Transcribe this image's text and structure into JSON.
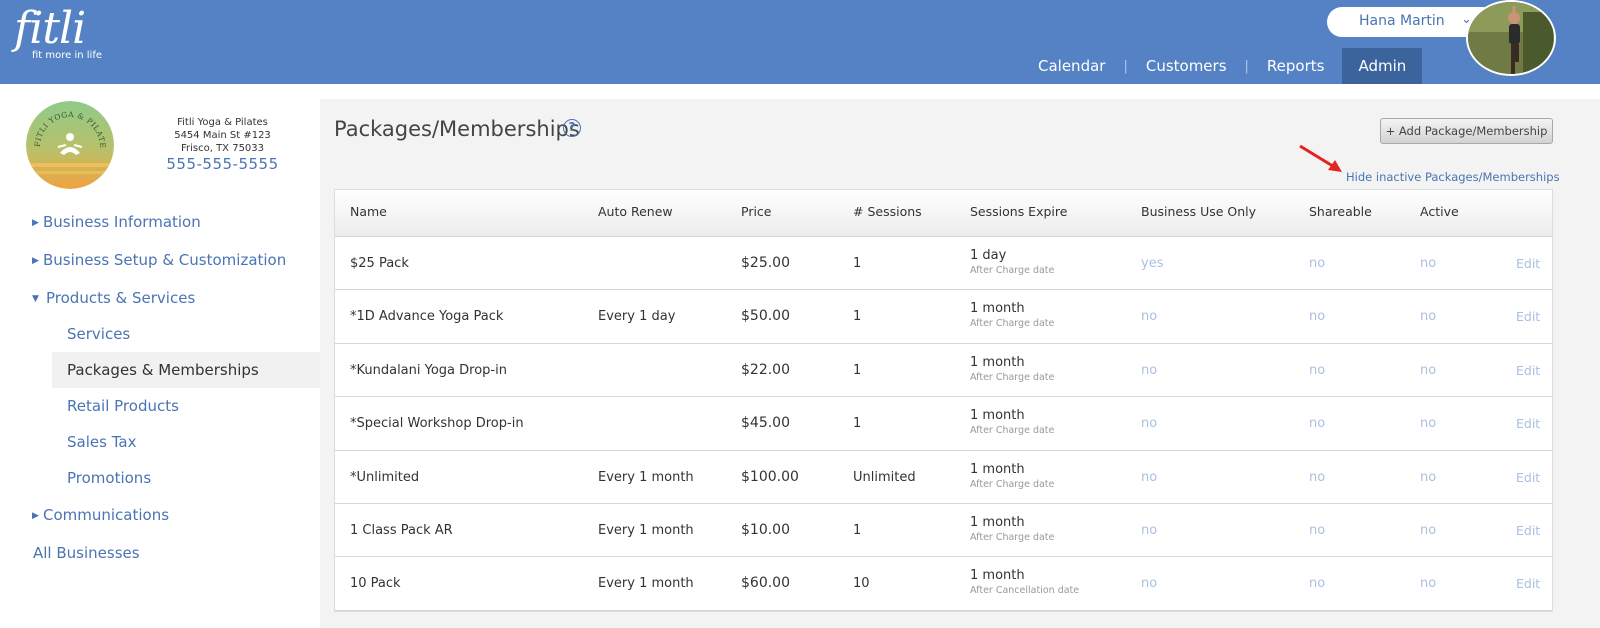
{
  "header": {
    "logo_word": "fitli",
    "logo_tagline": "fit more in life",
    "user_name": "Hana Martin",
    "nav": [
      {
        "label": "Calendar"
      },
      {
        "label": "Customers"
      },
      {
        "label": "Reports"
      },
      {
        "label": "Admin"
      }
    ]
  },
  "business": {
    "name": "Fitli Yoga & Pilates",
    "address1": "5454 Main St #123",
    "address2": "Frisco, TX 75033",
    "phone": "555-555-5555",
    "logo_text": "FITLI YOGA & PILATES"
  },
  "sidebar": {
    "business_information": "Business Information",
    "business_setup": "Business Setup & Customization",
    "products_services": "Products & Services",
    "sub": [
      "Services",
      "Packages & Memberships",
      "Retail Products",
      "Sales Tax",
      "Promotions"
    ],
    "communications": "Communications",
    "all_businesses": "All Businesses"
  },
  "main": {
    "title": "Packages/Memberships",
    "add_button": "+ Add Package/Membership",
    "hide_link": "Hide inactive Packages/Memberships",
    "columns": [
      "Name",
      "Auto Renew",
      "Price",
      "# Sessions",
      "Sessions Expire",
      "Business Use Only",
      "Shareable",
      "Active"
    ],
    "edit_label": "Edit",
    "rows": [
      {
        "name": "$25 Pack",
        "auto_renew": "",
        "price": "$25.00",
        "sessions": "1",
        "expire": "1 day",
        "expire_note": "After Charge date",
        "business_use": "yes",
        "shareable": "no",
        "active": "no"
      },
      {
        "name": "*1D Advance Yoga Pack",
        "auto_renew": "Every 1 day",
        "price": "$50.00",
        "sessions": "1",
        "expire": "1 month",
        "expire_note": "After Charge date",
        "business_use": "no",
        "shareable": "no",
        "active": "no"
      },
      {
        "name": "*Kundalani Yoga Drop-in",
        "auto_renew": "",
        "price": "$22.00",
        "sessions": "1",
        "expire": "1 month",
        "expire_note": "After Charge date",
        "business_use": "no",
        "shareable": "no",
        "active": "no"
      },
      {
        "name": "*Special Workshop Drop-in",
        "auto_renew": "",
        "price": "$45.00",
        "sessions": "1",
        "expire": "1 month",
        "expire_note": "After Charge date",
        "business_use": "no",
        "shareable": "no",
        "active": "no"
      },
      {
        "name": "*Unlimited",
        "auto_renew": "Every 1 month",
        "price": "$100.00",
        "sessions": "Unlimited",
        "expire": "1 month",
        "expire_note": "After Charge date",
        "business_use": "no",
        "shareable": "no",
        "active": "no"
      },
      {
        "name": "1 Class Pack AR",
        "auto_renew": "Every 1 month",
        "price": "$10.00",
        "sessions": "1",
        "expire": "1 month",
        "expire_note": "After Charge date",
        "business_use": "no",
        "shareable": "no",
        "active": "no"
      },
      {
        "name": "10 Pack",
        "auto_renew": "Every 1 month",
        "price": "$60.00",
        "sessions": "10",
        "expire": "1 month",
        "expire_note": "After Cancellation date",
        "business_use": "no",
        "shareable": "no",
        "active": "no"
      }
    ]
  },
  "colors": {
    "header_bg": "#5482c4",
    "active_nav": "#3c649c",
    "link": "#4a74b4",
    "muted_link": "#a9c0df",
    "arrow": "#e52222"
  }
}
